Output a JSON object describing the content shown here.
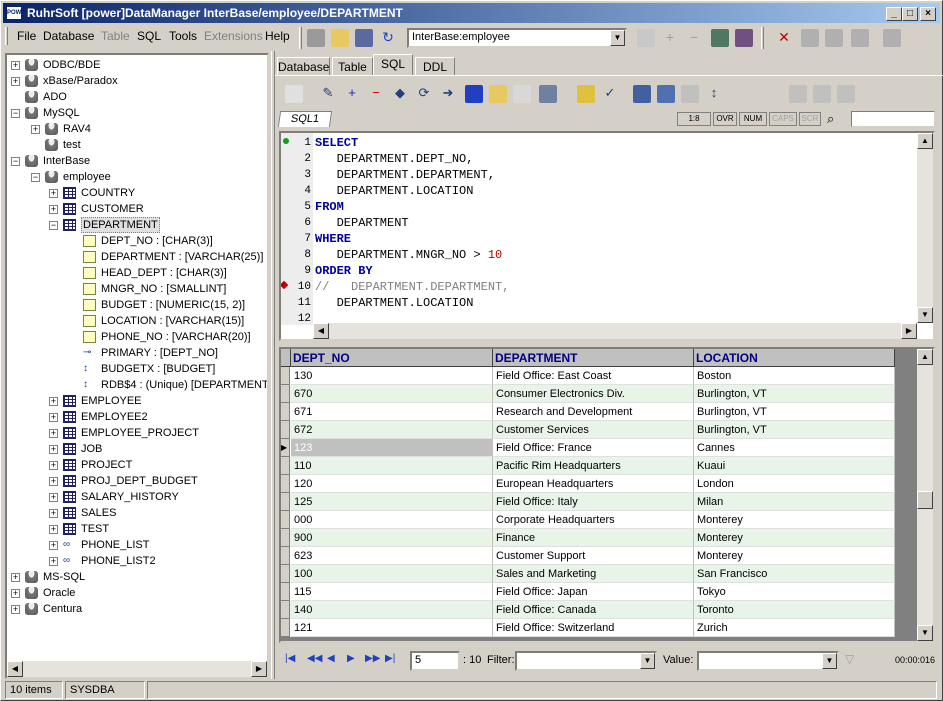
{
  "window": {
    "title": "RuhrSoft [power]DataManager InterBase/employee/DEPARTMENT",
    "app_icon_text": "POWER"
  },
  "menu": [
    {
      "label": "File",
      "enabled": true
    },
    {
      "label": "Database",
      "enabled": true
    },
    {
      "label": "Table",
      "enabled": false
    },
    {
      "label": "SQL",
      "enabled": true
    },
    {
      "label": "Tools",
      "enabled": true
    },
    {
      "label": "Extensions",
      "enabled": false
    },
    {
      "label": "Help",
      "enabled": true
    }
  ],
  "toolbar": {
    "connection_value": "InterBase:employee"
  },
  "tree": [
    {
      "label": "ODBC/BDE",
      "icon": "database-icon"
    },
    {
      "label": "xBase/Paradox",
      "icon": "database-icon"
    },
    {
      "label": "ADO",
      "icon": "database-icon"
    },
    {
      "label": "MySQL",
      "icon": "database-icon"
    },
    {
      "label": "RAV4",
      "icon": "database-icon"
    },
    {
      "label": "test",
      "icon": "database-icon"
    },
    {
      "label": "InterBase",
      "icon": "database-icon"
    },
    {
      "label": "employee",
      "icon": "database-icon"
    },
    {
      "label": "COUNTRY",
      "icon": "table-icon"
    },
    {
      "label": "CUSTOMER",
      "icon": "table-icon"
    },
    {
      "label": "DEPARTMENT",
      "icon": "table-icon"
    },
    {
      "label": "DEPT_NO : [CHAR(3)]",
      "icon": "field-icon"
    },
    {
      "label": "DEPARTMENT : [VARCHAR(25)]",
      "icon": "field-icon"
    },
    {
      "label": "HEAD_DEPT : [CHAR(3)]",
      "icon": "field-icon"
    },
    {
      "label": "MNGR_NO : [SMALLINT]",
      "icon": "field-icon"
    },
    {
      "label": "BUDGET : [NUMERIC(15, 2)]",
      "icon": "field-icon"
    },
    {
      "label": "LOCATION : [VARCHAR(15)]",
      "icon": "field-icon"
    },
    {
      "label": "PHONE_NO : [VARCHAR(20)]",
      "icon": "field-icon"
    },
    {
      "label": "PRIMARY : [DEPT_NO]",
      "icon": "key-icon"
    },
    {
      "label": "BUDGETX : [BUDGET]",
      "icon": "index-icon"
    },
    {
      "label": "RDB$4 : (Unique) [DEPARTMENT",
      "icon": "index-icon"
    },
    {
      "label": "EMPLOYEE",
      "icon": "table-icon"
    },
    {
      "label": "EMPLOYEE2",
      "icon": "table-icon"
    },
    {
      "label": "EMPLOYEE_PROJECT",
      "icon": "table-icon"
    },
    {
      "label": "JOB",
      "icon": "table-icon"
    },
    {
      "label": "PROJECT",
      "icon": "table-icon"
    },
    {
      "label": "PROJ_DEPT_BUDGET",
      "icon": "table-icon"
    },
    {
      "label": "SALARY_HISTORY",
      "icon": "table-icon"
    },
    {
      "label": "SALES",
      "icon": "table-icon"
    },
    {
      "label": "TEST",
      "icon": "table-icon"
    },
    {
      "label": "PHONE_LIST",
      "icon": "view-icon"
    },
    {
      "label": "PHONE_LIST2",
      "icon": "view-icon"
    },
    {
      "label": "MS-SQL",
      "icon": "database-icon"
    },
    {
      "label": "Oracle",
      "icon": "database-icon"
    },
    {
      "label": "Centura",
      "icon": "database-icon"
    }
  ],
  "tabs": [
    "Database",
    "Table",
    "SQL",
    "DDL"
  ],
  "active_tab": "SQL",
  "sql_tab": "SQL1",
  "editor_status": {
    "position": "1:8",
    "ovr": "OVR",
    "num": "NUM",
    "caps": "CAPS",
    "scr": "SCR"
  },
  "sql_lines": [
    {
      "n": "1",
      "parts": [
        [
          "kw",
          "SELECT"
        ]
      ]
    },
    {
      "n": "2",
      "parts": [
        [
          "",
          "   DEPARTMENT.DEPT_NO,"
        ]
      ]
    },
    {
      "n": "3",
      "parts": [
        [
          "",
          "   DEPARTMENT.DEPARTMENT,"
        ]
      ]
    },
    {
      "n": "4",
      "parts": [
        [
          "",
          "   DEPARTMENT.LOCATION"
        ]
      ]
    },
    {
      "n": "5",
      "parts": [
        [
          "kw",
          "FROM"
        ]
      ]
    },
    {
      "n": "6",
      "parts": [
        [
          "",
          "   DEPARTMENT"
        ]
      ]
    },
    {
      "n": "7",
      "parts": [
        [
          "kw",
          "WHERE"
        ]
      ]
    },
    {
      "n": "8",
      "parts": [
        [
          "",
          "   DEPARTMENT.MNGR_NO > "
        ],
        [
          "nm",
          "10"
        ]
      ]
    },
    {
      "n": "9",
      "parts": [
        [
          "kw",
          "ORDER BY"
        ]
      ]
    },
    {
      "n": "10",
      "parts": [
        [
          "cm",
          "//   DEPARTMENT.DEPARTMENT,"
        ]
      ]
    },
    {
      "n": "11",
      "parts": [
        [
          "",
          "   DEPARTMENT.LOCATION"
        ]
      ]
    },
    {
      "n": "12",
      "parts": [
        [
          "",
          ""
        ]
      ]
    }
  ],
  "grid": {
    "columns": [
      "DEPT_NO",
      "DEPARTMENT",
      "LOCATION"
    ],
    "current_row": 4,
    "rows": [
      [
        "130",
        "Field Office: East Coast",
        "Boston"
      ],
      [
        "670",
        "Consumer Electronics Div.",
        "Burlington, VT"
      ],
      [
        "671",
        "Research and Development",
        "Burlington, VT"
      ],
      [
        "672",
        "Customer Services",
        "Burlington, VT"
      ],
      [
        "123",
        "Field Office: France",
        "Cannes"
      ],
      [
        "110",
        "Pacific Rim Headquarters",
        "Kuaui"
      ],
      [
        "120",
        "European Headquarters",
        "London"
      ],
      [
        "125",
        "Field Office: Italy",
        "Milan"
      ],
      [
        "000",
        "Corporate Headquarters",
        "Monterey"
      ],
      [
        "900",
        "Finance",
        "Monterey"
      ],
      [
        "623",
        "Customer Support",
        "Monterey"
      ],
      [
        "100",
        "Sales and Marketing",
        "San Francisco"
      ],
      [
        "115",
        "Field Office: Japan",
        "Tokyo"
      ],
      [
        "140",
        "Field Office: Canada",
        "Toronto"
      ],
      [
        "121",
        "Field Office: Switzerland",
        "Zurich"
      ]
    ]
  },
  "navigator": {
    "record": "5",
    "total": ": 10",
    "filter_label": "Filter:",
    "value_label": "Value:",
    "timer": "00:00:016"
  },
  "statusbar": {
    "items": "10 items",
    "user": "SYSDBA"
  },
  "colors": {
    "title_start": "#0a246a",
    "keyword": "#0000a0",
    "comment": "#808080",
    "number": "#c00000",
    "grid_alt": "#e8f4e8",
    "header_text": "#000080"
  }
}
